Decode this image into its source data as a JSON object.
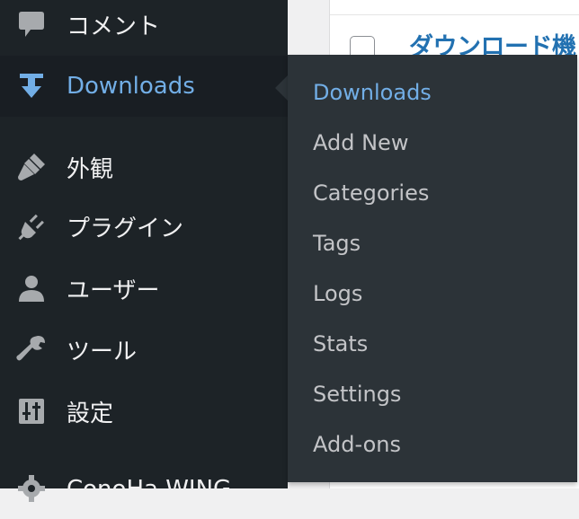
{
  "content": {
    "post_title": "ダウンロード機"
  },
  "sidebar": {
    "items": [
      {
        "label": "コメント",
        "icon": "comment-icon"
      },
      {
        "label": "Downloads",
        "icon": "download-icon",
        "current": true
      },
      {
        "label": "外観",
        "icon": "paintbrush-icon"
      },
      {
        "label": "プラグイン",
        "icon": "plugin-icon"
      },
      {
        "label": "ユーザー",
        "icon": "user-icon"
      },
      {
        "label": "ツール",
        "icon": "wrench-icon"
      },
      {
        "label": "設定",
        "icon": "settings-sliders-icon"
      },
      {
        "label": "ConoHa WING",
        "icon": "gear-icon"
      }
    ]
  },
  "flyout": {
    "items": [
      {
        "label": "Downloads",
        "active": true
      },
      {
        "label": "Add New"
      },
      {
        "label": "Categories"
      },
      {
        "label": "Tags"
      },
      {
        "label": "Logs"
      },
      {
        "label": "Stats"
      },
      {
        "label": "Settings"
      },
      {
        "label": "Add-ons"
      }
    ]
  },
  "colors": {
    "sidebar_bg": "#1d2327",
    "flyout_bg": "#2c3338",
    "accent": "#72aee6",
    "text": "#f0f0f1",
    "link": "#2271b1"
  }
}
